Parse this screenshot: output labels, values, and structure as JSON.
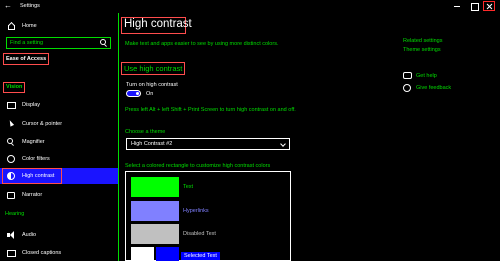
{
  "window": {
    "back_glyph": "←",
    "title": "Settings"
  },
  "sidebar": {
    "home_label": "Home",
    "search_placeholder": "Find a setting",
    "section_ease": "Ease of Access",
    "section_vision": "Vision",
    "vision_items": [
      {
        "label": "Display",
        "icon": "display-icon"
      },
      {
        "label": "Cursor & pointer",
        "icon": "cursor-icon"
      },
      {
        "label": "Magnifier",
        "icon": "magnifier-icon"
      },
      {
        "label": "Color filters",
        "icon": "color-filters-icon"
      },
      {
        "label": "High contrast",
        "icon": "contrast-icon",
        "selected": true
      },
      {
        "label": "Narrator",
        "icon": "narrator-icon"
      }
    ],
    "section_hearing": "Hearing",
    "hearing_items": [
      {
        "label": "Audio",
        "icon": "audio-icon"
      },
      {
        "label": "Closed captions",
        "icon": "captions-icon"
      }
    ]
  },
  "main": {
    "title": "High contrast",
    "intro": "Make text and apps easier to see by using more distinct colors.",
    "section_title": "Use high contrast",
    "toggle_label": "Turn on high contrast",
    "toggle_state": "On",
    "toggle_on": true,
    "hint": "Press left Alt + left Shift + Print Screen to turn high contrast on and off.",
    "theme_label": "Choose a theme",
    "theme_value": "High Contrast #2",
    "colors_label": "Select a colored rectangle to customize high contrast colors",
    "swatches": [
      {
        "label": "Text",
        "color": "#00ff00",
        "label_color": "#00dd00"
      },
      {
        "label": "Hyperlinks",
        "color": "#8080ff",
        "label_color": "#8080ff"
      },
      {
        "label": "Disabled Text",
        "color": "#c0c0c0",
        "label_color": "#c0c0c0"
      },
      {
        "label": "Selected Text",
        "color_left": "#ffffff",
        "color_right": "#0000ff",
        "label_color": "#ffffff"
      }
    ]
  },
  "related": {
    "title": "Related settings",
    "theme_settings": "Theme settings",
    "get_help": "Get help",
    "give_feedback": "Give feedback"
  },
  "colors": {
    "background": "#000000",
    "accent_green": "#00dd00",
    "selection_blue": "#1a14ff",
    "annotation_red": "#ff4d4d"
  }
}
